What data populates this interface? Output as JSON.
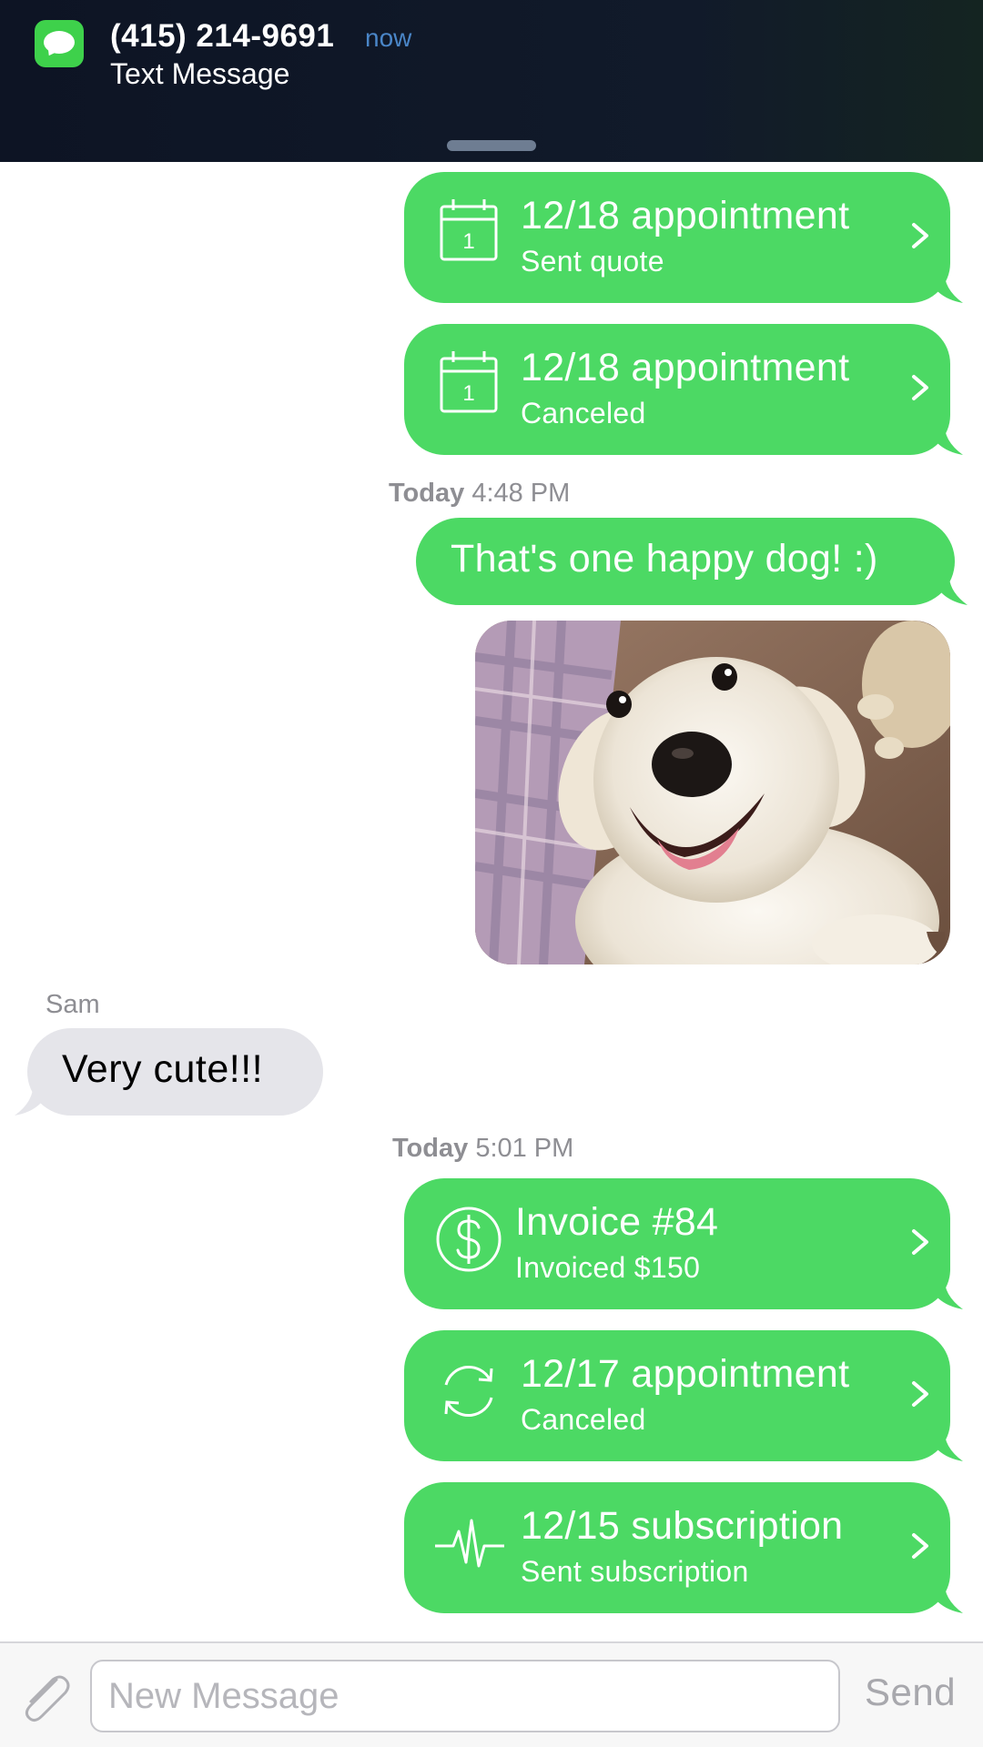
{
  "notification": {
    "sender": "(415) 214-9691",
    "time": "now",
    "subtitle": "Text Message",
    "app_icon": "messages-icon"
  },
  "messages": {
    "cards_top": [
      {
        "icon": "calendar-icon",
        "icon_day": "1",
        "title": "12/18 appointment",
        "subtitle": "Sent quote"
      },
      {
        "icon": "calendar-icon",
        "icon_day": "1",
        "title": "12/18 appointment",
        "subtitle": "Canceled"
      }
    ],
    "timestamp_1": {
      "day": "Today",
      "time": "4:48 PM"
    },
    "outgoing_text": "That's one happy dog! :)",
    "photo_alt": "dog-photo",
    "incoming": {
      "sender": "Sam",
      "text": "Very cute!!!"
    },
    "timestamp_2": {
      "day": "Today",
      "time": "5:01 PM"
    },
    "cards_bottom": [
      {
        "icon": "dollar-icon",
        "title": "Invoice #84",
        "subtitle": "Invoiced $150"
      },
      {
        "icon": "refresh-icon",
        "title": "12/17 appointment",
        "subtitle": "Canceled"
      },
      {
        "icon": "pulse-icon",
        "title": "12/15 subscription",
        "subtitle": "Sent subscription"
      }
    ]
  },
  "composer": {
    "placeholder": "New Message",
    "value": "",
    "send_label": "Send",
    "attach_icon": "paperclip-icon"
  },
  "colors": {
    "bubble_green": "#4cd964",
    "bubble_gray": "#e5e5ea",
    "banner_bg": "#0d1424",
    "timestamp_gray": "#8e8e93",
    "now_blue": "#4a86c8"
  }
}
